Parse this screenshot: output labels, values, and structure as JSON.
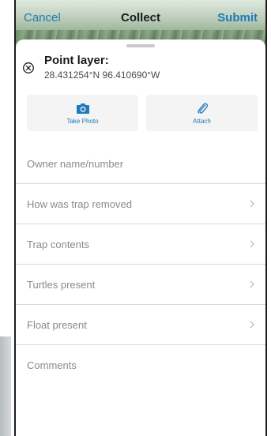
{
  "nav": {
    "cancel": "Cancel",
    "title": "Collect",
    "submit": "Submit"
  },
  "location": {
    "layer": "Point layer:",
    "coords": "28.431254°N  96.410690°W"
  },
  "actions": {
    "photo": "Take Photo",
    "attach": "Attach"
  },
  "fields": [
    {
      "label": "Owner name/number",
      "has_chevron": false
    },
    {
      "label": "How was trap removed",
      "has_chevron": true
    },
    {
      "label": "Trap contents",
      "has_chevron": true
    },
    {
      "label": "Turtles present",
      "has_chevron": true
    },
    {
      "label": "Float present",
      "has_chevron": true
    },
    {
      "label": "Comments",
      "has_chevron": false
    }
  ],
  "colors": {
    "accent": "#1f7ab8",
    "text": "#1a1a1a",
    "placeholder": "#8a8a8a",
    "divider": "#d9d9d9",
    "action_bg": "#f4f4f4"
  },
  "icons": {
    "close": "close-circle-x-icon",
    "camera": "camera-icon",
    "attach": "paperclip-icon",
    "chevron": "chevron-right-icon"
  }
}
